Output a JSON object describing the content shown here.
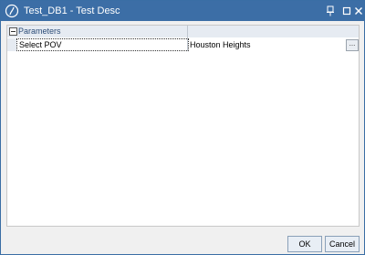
{
  "window": {
    "title": "Test_DB1 - Test Desc"
  },
  "grid": {
    "category_label": "Parameters",
    "rows": [
      {
        "name": "Select POV",
        "value": "Houston Heights",
        "button_label": "..."
      }
    ]
  },
  "footer": {
    "ok_label": "OK",
    "cancel_label": "Cancel"
  },
  "colors": {
    "titlebar": "#3c6ea6",
    "category_bg": "#e6ebf2",
    "button_bg": "#e8eef5"
  }
}
